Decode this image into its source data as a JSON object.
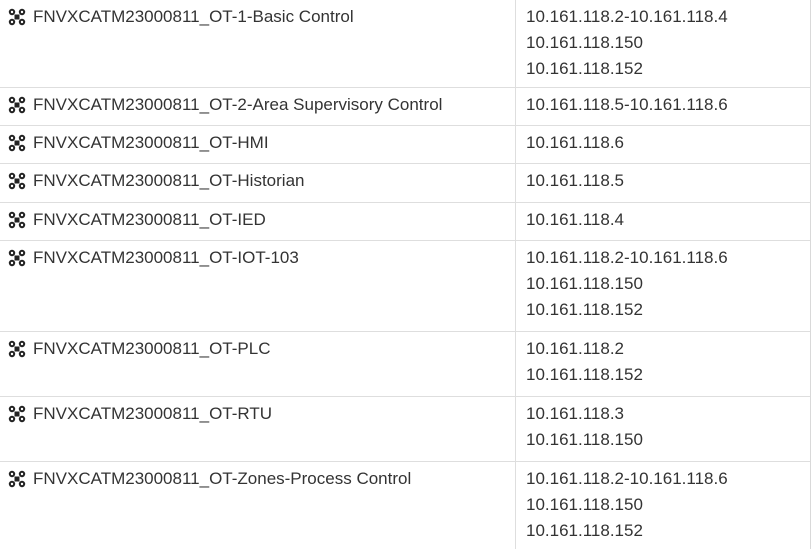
{
  "table": {
    "rows": [
      {
        "icon": "address-group-icon",
        "name": "FNVXCATM23000811_OT-1-Basic Control",
        "addresses": [
          "10.161.118.2-10.161.118.4",
          "10.161.118.150",
          "10.161.118.152"
        ]
      },
      {
        "icon": "address-group-icon",
        "name": "FNVXCATM23000811_OT-2-Area Supervisory Control",
        "addresses": [
          "10.161.118.5-10.161.118.6"
        ]
      },
      {
        "icon": "address-group-icon",
        "name": "FNVXCATM23000811_OT-HMI",
        "addresses": [
          "10.161.118.6"
        ]
      },
      {
        "icon": "address-group-icon",
        "name": "FNVXCATM23000811_OT-Historian",
        "addresses": [
          "10.161.118.5"
        ]
      },
      {
        "icon": "address-group-icon",
        "name": "FNVXCATM23000811_OT-IED",
        "addresses": [
          "10.161.118.4"
        ]
      },
      {
        "icon": "address-group-icon",
        "name": "FNVXCATM23000811_OT-IOT-103",
        "addresses": [
          "10.161.118.2-10.161.118.6",
          "10.161.118.150",
          "10.161.118.152"
        ]
      },
      {
        "icon": "address-group-icon",
        "name": "FNVXCATM23000811_OT-PLC",
        "addresses": [
          "10.161.118.2",
          "10.161.118.152"
        ]
      },
      {
        "icon": "address-group-icon",
        "name": "FNVXCATM23000811_OT-RTU",
        "addresses": [
          "10.161.118.3",
          "10.161.118.150"
        ]
      },
      {
        "icon": "address-group-icon",
        "name": "FNVXCATM23000811_OT-Zones-Process Control",
        "addresses": [
          "10.161.118.2-10.161.118.6",
          "10.161.118.150",
          "10.161.118.152"
        ]
      }
    ]
  }
}
